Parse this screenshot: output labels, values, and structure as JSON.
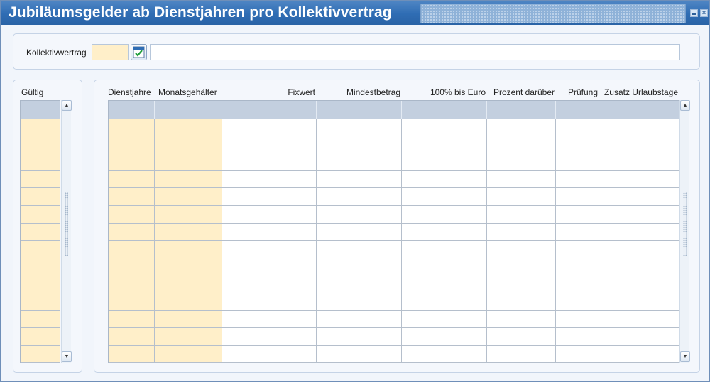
{
  "window": {
    "title": "Jubiläumsgelder ab Dienstjahren pro Kollektivvertrag"
  },
  "header": {
    "kollektivvertrag_label": "Kollektivwertrag"
  },
  "left_block": {
    "label": "Gültig",
    "row_count": 14
  },
  "main_block": {
    "columns": [
      {
        "key": "dienstjahre",
        "label": "Dienstjahre"
      },
      {
        "key": "monatsgehaelter",
        "label": "Monatsgehälter"
      },
      {
        "key": "fixwert",
        "label": "Fixwert"
      },
      {
        "key": "mindestbetrag",
        "label": "Mindestbetrag"
      },
      {
        "key": "100_bis_euro",
        "label": "100% bis Euro"
      },
      {
        "key": "prozent_darueber",
        "label": "Prozent darüber"
      },
      {
        "key": "pruefung",
        "label": "Prüfung"
      },
      {
        "key": "zusatz_urlaubstage",
        "label": "Zusatz Urlaubstage"
      }
    ],
    "row_count": 14
  },
  "icons": {
    "lov": "calendar-check-icon",
    "scroll_up": "arrow-up-icon",
    "scroll_down": "arrow-down-icon",
    "minimize": "minimize-icon",
    "close": "close-icon"
  },
  "colors": {
    "title_bar": "#2f6db4",
    "required_field": "#ffefc9",
    "grid_header": "#c3cfdf"
  }
}
